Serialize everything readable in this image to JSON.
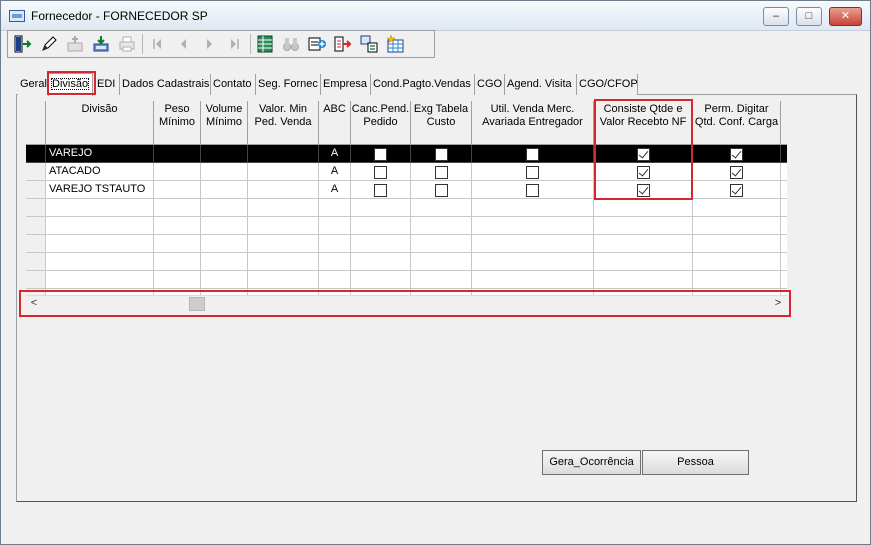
{
  "window": {
    "title": "Fornecedor - FORNECEDOR SP",
    "minimize": "–",
    "maximize": "□",
    "close": "✕"
  },
  "toolbar": {
    "buttons": [
      {
        "icon": "exit-icon",
        "enabled": true
      },
      {
        "icon": "pencil-icon",
        "enabled": true
      },
      {
        "icon": "add-record-icon",
        "enabled": false
      },
      {
        "icon": "save-icon",
        "enabled": true
      },
      {
        "icon": "print-icon",
        "enabled": false
      },
      {
        "icon": "first-record-icon",
        "enabled": false
      },
      {
        "icon": "previous-record-icon",
        "enabled": false
      },
      {
        "icon": "next-record-icon",
        "enabled": false
      },
      {
        "icon": "last-record-icon",
        "enabled": false
      },
      {
        "icon": "grid-icon",
        "enabled": true
      },
      {
        "icon": "binoculars-icon",
        "enabled": false
      },
      {
        "icon": "add-form-icon",
        "enabled": true
      },
      {
        "icon": "export-icon",
        "enabled": true
      },
      {
        "icon": "list-icon",
        "enabled": true
      },
      {
        "icon": "table-star-icon",
        "enabled": true
      }
    ]
  },
  "tabs": [
    "Geral",
    "Divisão",
    "EDI",
    "Dados Cadastrais",
    "Contato",
    "Seg. Fornec",
    "Empresa",
    "Cond.Pagto.Vendas",
    "CGO",
    "Agend. Visita",
    "CGO/CFOP"
  ],
  "active_tab": "Divisão",
  "grid": {
    "columns": [
      {
        "label": "Divisão"
      },
      {
        "label": "Peso Mínimo"
      },
      {
        "label": "Volume Mínimo"
      },
      {
        "label": "Valor. Min Ped. Venda"
      },
      {
        "label": "ABC"
      },
      {
        "label": "Canc.Pend. Pedido"
      },
      {
        "label": "Exg Tabela Custo"
      },
      {
        "label": "Util. Venda Merc. Avariada Entregador"
      },
      {
        "label": "Consiste Qtde e Valor Recebto NF"
      },
      {
        "label": "Perm. Digitar Qtd. Conf. Carga"
      }
    ],
    "rows": [
      {
        "divisao": "VAREJO",
        "abc": "A",
        "canc": false,
        "exg": false,
        "util": false,
        "consiste": true,
        "perm": true,
        "selected": true
      },
      {
        "divisao": "ATACADO",
        "abc": "A",
        "canc": false,
        "exg": false,
        "util": false,
        "consiste": true,
        "perm": true,
        "selected": false
      },
      {
        "divisao": "VAREJO TSTAUTO",
        "abc": "A",
        "canc": false,
        "exg": false,
        "util": false,
        "consiste": true,
        "perm": true,
        "selected": false
      }
    ]
  },
  "scrollbar": {
    "left_arrow": "<",
    "right_arrow": ">"
  },
  "buttons": {
    "gera_ocorrencia": "Gera_Ocorrência",
    "pessoa": "Pessoa"
  },
  "colors": {
    "highlight": "#d8262f",
    "selected_row": "#000000"
  }
}
